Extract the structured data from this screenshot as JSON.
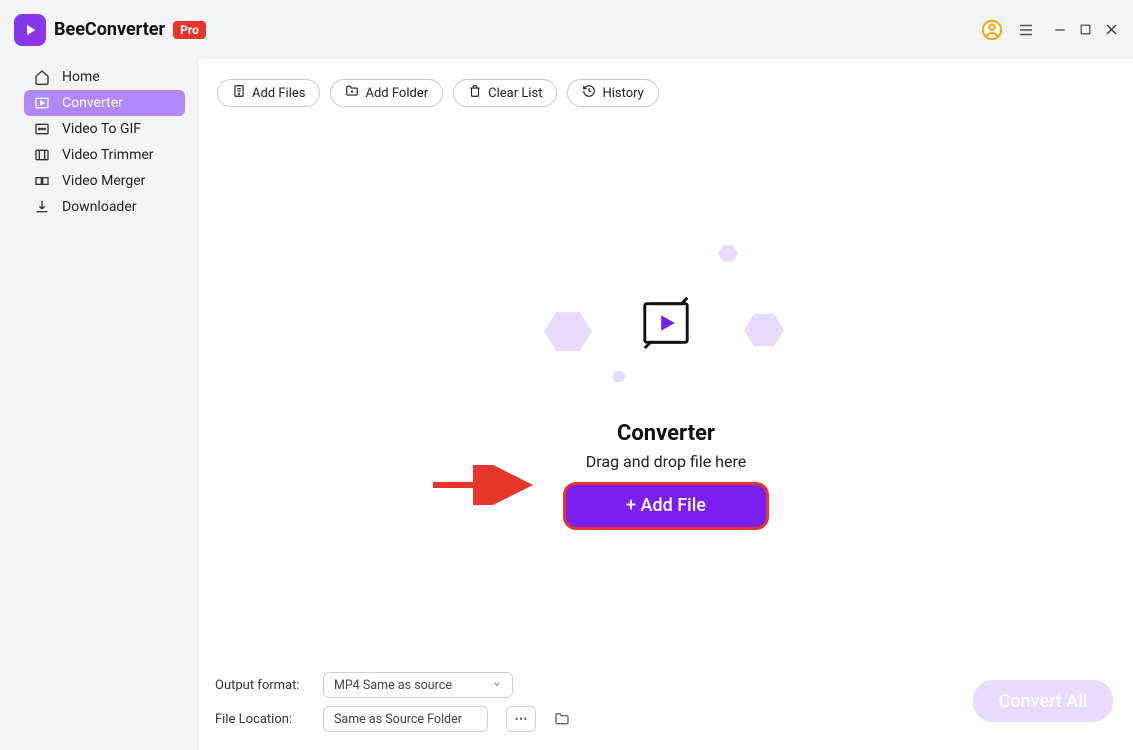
{
  "titlebar": {
    "app_name": "BeeConverter",
    "pro_badge": "Pro"
  },
  "sidebar": {
    "items": [
      {
        "label": "Home"
      },
      {
        "label": "Converter"
      },
      {
        "label": "Video To GIF"
      },
      {
        "label": "Video Trimmer"
      },
      {
        "label": "Video Merger"
      },
      {
        "label": "Downloader"
      }
    ]
  },
  "toolbar": {
    "add_files": "Add Files",
    "add_folder": "Add Folder",
    "clear_list": "Clear List",
    "history": "History"
  },
  "center": {
    "title": "Converter",
    "subtitle": "Drag and drop file here",
    "add_file_btn": "+ Add File"
  },
  "bottom": {
    "output_format_label": "Output format:",
    "output_format_value": "MP4 Same as source",
    "file_location_label": "File Location:",
    "file_location_value": "Same as Source Folder",
    "convert_all": "Convert All"
  }
}
